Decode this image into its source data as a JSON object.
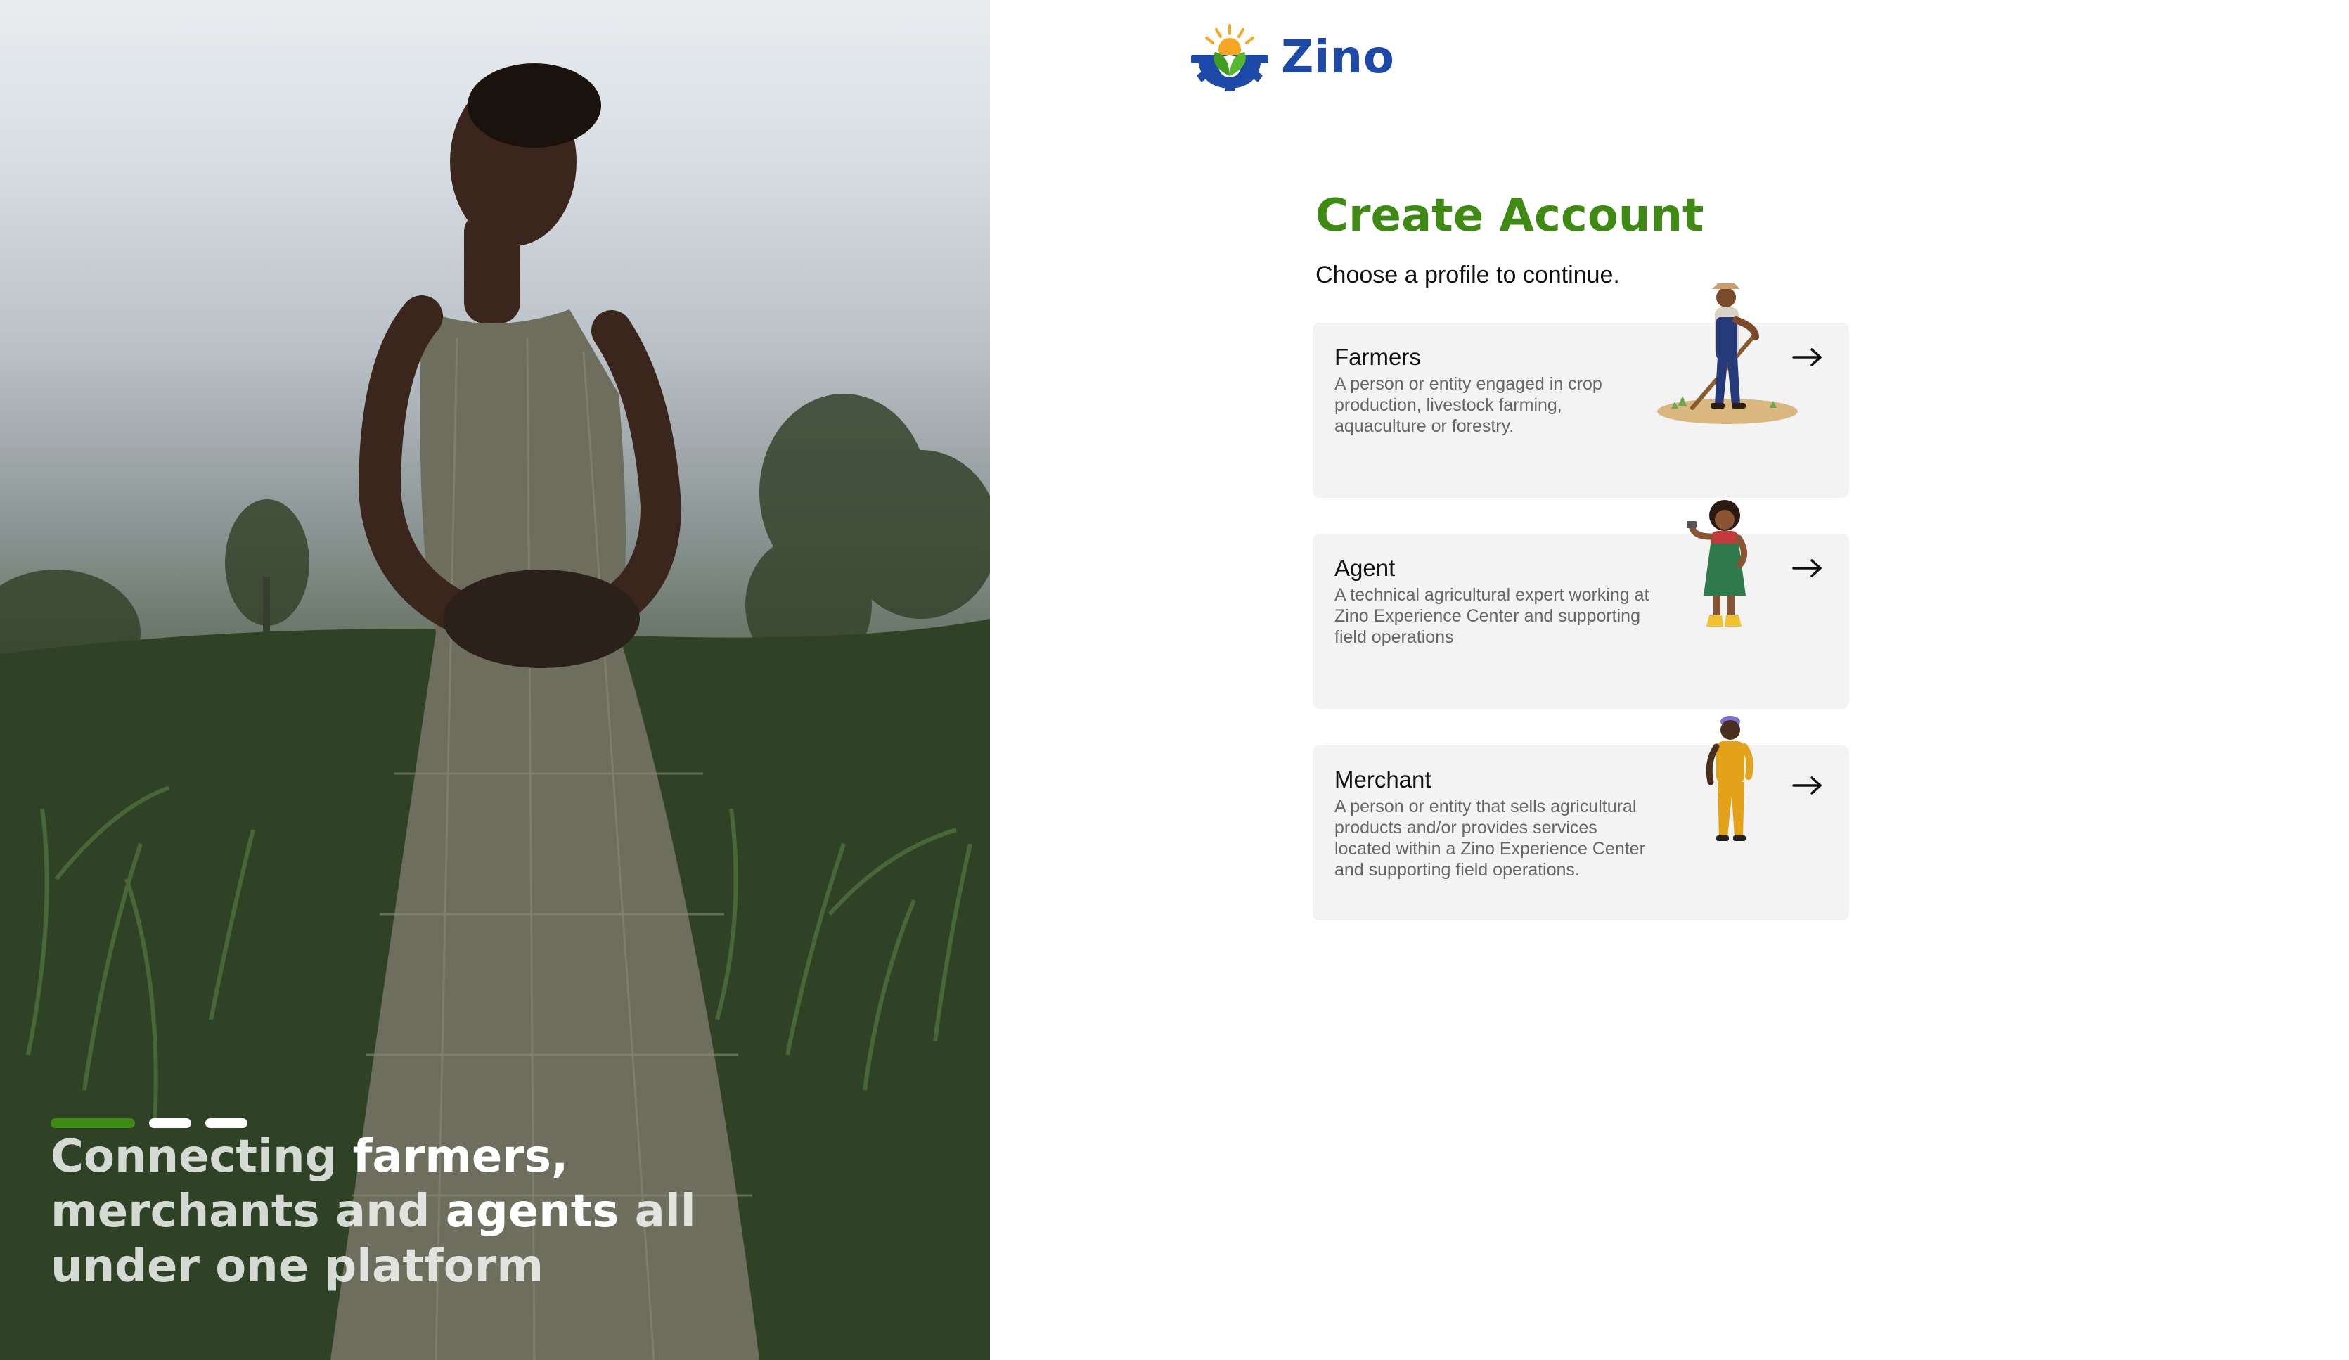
{
  "hero": {
    "tagline": {
      "p1": "Connecting ",
      "h1": "farmers,",
      "p2": "merchants and ",
      "h2": "agents",
      "p3": " all under one platform"
    },
    "pager": {
      "count": 3,
      "active_index": 0
    }
  },
  "brand": {
    "name": "Zino"
  },
  "form": {
    "title": "Create Account",
    "subtitle": "Choose a profile to continue.",
    "profiles": [
      {
        "title": "Farmers",
        "description": "A person or entity engaged in crop production, livestock farming, aquaculture or forestry.",
        "icon": "farmer-illustration-icon"
      },
      {
        "title": "Agent",
        "description": "A technical agricultural expert working at Zino Experience Center and supporting field operations",
        "icon": "agent-illustration-icon"
      },
      {
        "title": "Merchant",
        "description": "A person or entity that sells agricultural products and/or provides services located within a Zino Experience Center and supporting field operations.",
        "icon": "merchant-illustration-icon"
      }
    ]
  },
  "colors": {
    "accent_green": "#3f8a12",
    "brand_blue": "#1d4aa8",
    "card_bg": "#f3f3f3",
    "sun_orange": "#f5a623"
  }
}
